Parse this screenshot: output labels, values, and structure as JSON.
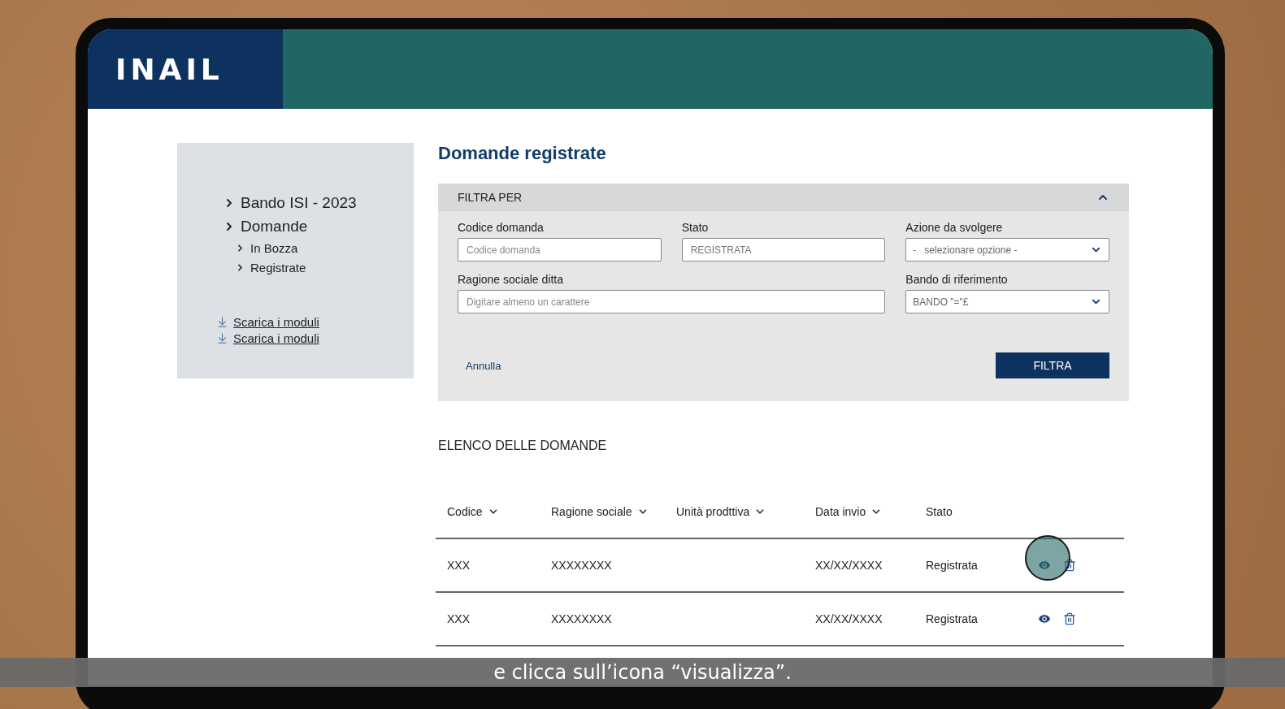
{
  "brand": {
    "logo": "INAIL"
  },
  "sidebar": {
    "items": [
      {
        "label": "Bando ISI - 2023"
      },
      {
        "label": "Domande",
        "children": [
          {
            "label": "In Bozza"
          },
          {
            "label": "Registrate"
          }
        ]
      }
    ],
    "downloads": [
      "Scarica i moduli",
      "Scarica i moduli"
    ]
  },
  "page_title": "Domande registrate",
  "filter": {
    "title": "FILTRA PER",
    "expanded": true,
    "fields": [
      {
        "kind": "text",
        "label": "Codice domanda",
        "placeholder": "Codice domanda",
        "wide": false
      },
      {
        "kind": "text",
        "label": "Stato",
        "value": "REGISTRATA",
        "wide": false
      },
      {
        "kind": "select",
        "label": "Azione da svolgere",
        "value": "-   selezionare opzione -",
        "wide": false
      },
      {
        "kind": "text",
        "label": "Ragione sociale ditta",
        "placeholder": "Digitare almeno un carattere",
        "wide": true
      },
      {
        "kind": "select",
        "label": "Bando di riferimento",
        "value": "BANDO \"=\"£",
        "wide": false
      }
    ],
    "cancel": "Annulla",
    "submit": "FILTRA"
  },
  "list": {
    "title": "ELENCO DELLE DOMANDE",
    "columns": [
      {
        "label": "Codice",
        "sortable": true
      },
      {
        "label": "Ragione sociale",
        "sortable": true
      },
      {
        "label": "Unità prodttiva",
        "sortable": true
      },
      {
        "label": "Data invio",
        "sortable": true
      },
      {
        "label": "Stato",
        "sortable": false
      }
    ],
    "rows": [
      {
        "codice": "XXX",
        "ragione_sociale": "XXXXXXXX",
        "data_invio": "XX/XX/XXXX",
        "stato": "Registrata",
        "highlighted": true
      },
      {
        "codice": "XXX",
        "ragione_sociale": "XXXXXXXX",
        "data_invio": "XX/XX/XXXX",
        "stato": "Registrata",
        "highlighted": false
      }
    ]
  },
  "subtitle": "e clicca sull’icona “visualizza”."
}
